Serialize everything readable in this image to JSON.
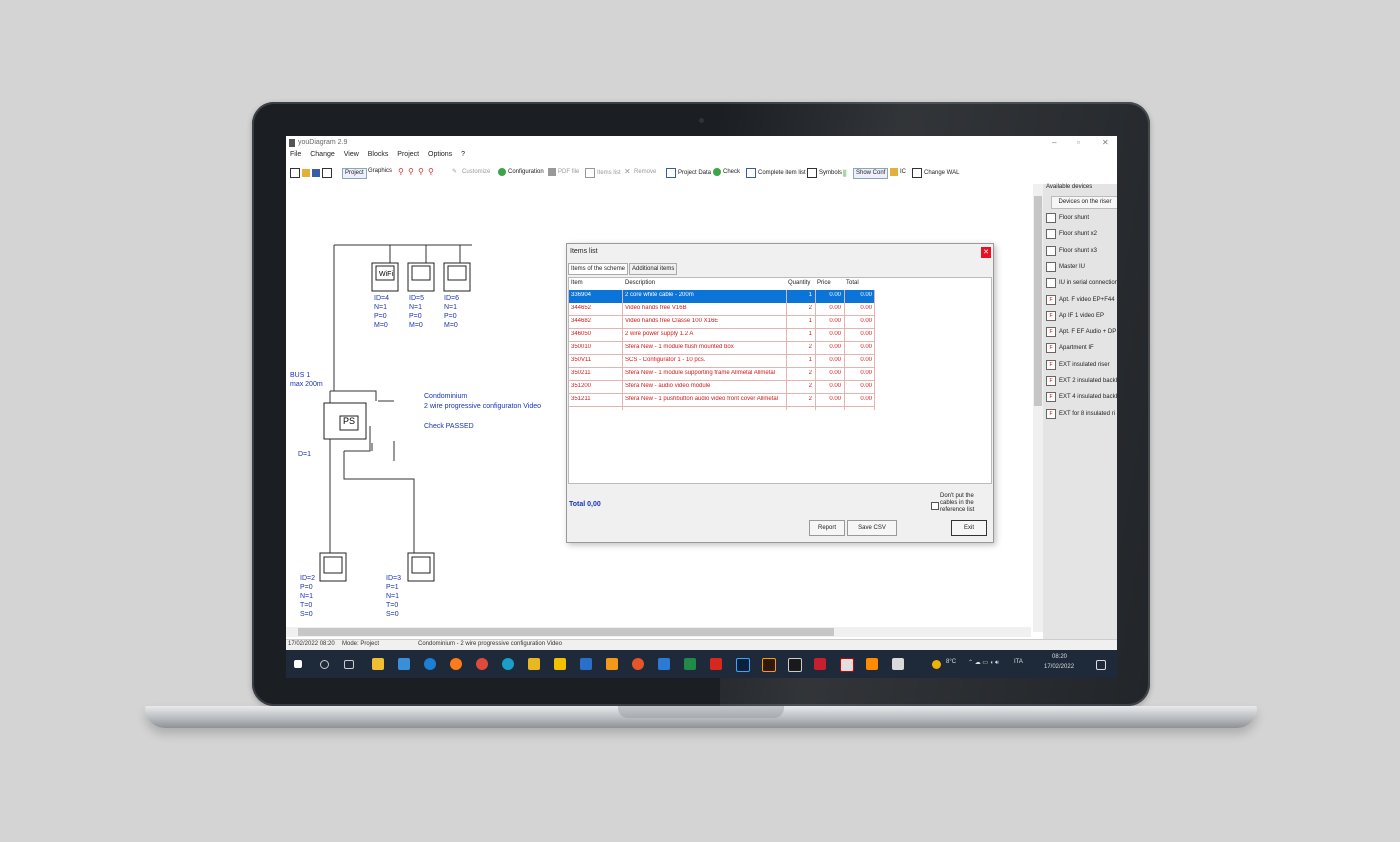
{
  "app": {
    "title": "youDiagram 2.9",
    "window_controls": [
      "–",
      "▫",
      "✕"
    ]
  },
  "menu": [
    "File",
    "Change",
    "View",
    "Blocks",
    "Project",
    "Options",
    "?"
  ],
  "toolbar": {
    "project": "Project",
    "graphics": "Graphics",
    "customize": "Customize",
    "configuration": "Configuration",
    "pdf_file": "PDF file",
    "items_list": "Items list",
    "remove": "Remove",
    "project_data": "Project Data",
    "check": "Check",
    "complete_item_list": "Complete item list",
    "symbols": "Symbols",
    "show_conf": "Show Conf",
    "ic": "IC",
    "change_wal": "Change WAL"
  },
  "diagram": {
    "monitor_wifi": "WiFi",
    "monitors": [
      {
        "id": "ID=4",
        "n": "N=1",
        "p": "P=0",
        "m": "M=0"
      },
      {
        "id": "ID=5",
        "n": "N=1",
        "p": "P=0",
        "m": "M=0"
      },
      {
        "id": "ID=6",
        "n": "N=1",
        "p": "P=0",
        "m": "M=0"
      }
    ],
    "bus_label": "BUS 1\nmax 200m",
    "ps_label": "PS",
    "ps_id": "D=1",
    "condominium": "Condominium",
    "description": "2 wire progressive configuraton Video",
    "check": "Check PASSED",
    "panels": [
      {
        "lines": "ID=2\nP=0\nN=1\nT=0\nS=0"
      },
      {
        "lines": "ID=3\nP=1\nN=1\nT=0\nS=0"
      }
    ]
  },
  "dialog": {
    "title": "Items list",
    "tabs": [
      "Items of the scheme",
      "Additional items"
    ],
    "headers": {
      "item": "Item",
      "description": "Description",
      "quantity": "Quantity",
      "price": "Price",
      "total": "Total"
    },
    "rows": [
      {
        "item": "336904",
        "description": "2 core white cable - 200m",
        "quantity": "1",
        "price": "0.00",
        "total": "0.00"
      },
      {
        "item": "344652",
        "description": "Video hands free V16B",
        "quantity": "2",
        "price": "0.00",
        "total": "0.00"
      },
      {
        "item": "344682",
        "description": "Video hands free Classe 100 X16E",
        "quantity": "1",
        "price": "0.00",
        "total": "0.00"
      },
      {
        "item": "346050",
        "description": "2 wire power supply 1.2 A",
        "quantity": "1",
        "price": "0.00",
        "total": "0.00"
      },
      {
        "item": "350010",
        "description": "Sfera New - 1 module flush mounted box",
        "quantity": "2",
        "price": "0.00",
        "total": "0.00"
      },
      {
        "item": "350V11",
        "description": "SCS - Configurator 1 - 10 pcs.",
        "quantity": "1",
        "price": "0.00",
        "total": "0.00"
      },
      {
        "item": "350211",
        "description": "Sfera New - 1 module supporting frame Allmetal Allmetal",
        "quantity": "2",
        "price": "0.00",
        "total": "0.00"
      },
      {
        "item": "351200",
        "description": "Sfera New - audio video module",
        "quantity": "2",
        "price": "0.00",
        "total": "0.00"
      },
      {
        "item": "351211",
        "description": "Sfera New - 1 pushbutton audio video front cover Allmetal",
        "quantity": "2",
        "price": "0.00",
        "total": "0.00"
      }
    ],
    "total_label": "Total 0,00",
    "checkbox_label": "Don't put the cables in the reference list",
    "buttons": {
      "report": "Report",
      "save_csv": "Save CSV",
      "exit": "Exit"
    }
  },
  "panel": {
    "header": "Available devices",
    "tab": "Devices on the riser",
    "items": [
      {
        "label": "Floor shunt",
        "icon": "shunt-icon"
      },
      {
        "label": "Floor shunt x2",
        "icon": "shunt-icon"
      },
      {
        "label": "Floor shunt x3",
        "icon": "shunt-icon"
      },
      {
        "label": "Master IU",
        "icon": "master-icon"
      },
      {
        "label": "IU in serial connection",
        "icon": "master-icon"
      },
      {
        "label": "Apt. F video EP+F44",
        "icon": "apt-icon"
      },
      {
        "label": "Ap IF 1 video EP",
        "icon": "apt-icon"
      },
      {
        "label": "Apt. F EF Audio + DP",
        "icon": "apt-icon"
      },
      {
        "label": "Apartment IF",
        "icon": "apt-icon"
      },
      {
        "label": "EXT insulated riser",
        "icon": "apt-icon"
      },
      {
        "label": "EXT 2 insulated backb",
        "icon": "apt-icon"
      },
      {
        "label": "EXT 4 insulated backb",
        "icon": "apt-icon"
      },
      {
        "label": "EXT for 8 insulated ri",
        "icon": "apt-icon"
      }
    ]
  },
  "status": {
    "datetime": "17/02/2022 08:20",
    "mode": "Mode: Project",
    "project": "Condominium - 2 wire progressive configuration Video"
  },
  "taskbar": {
    "weather": "8°C",
    "language": "ITA",
    "time": "08:20",
    "date": "17/02/2022"
  }
}
